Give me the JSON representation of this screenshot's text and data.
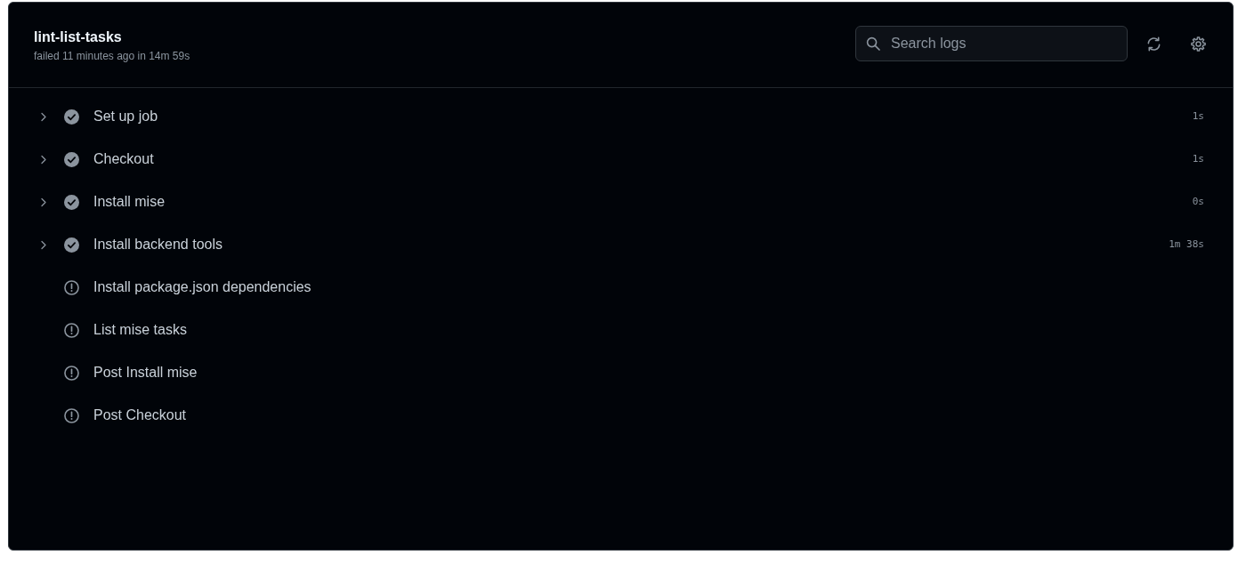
{
  "job": {
    "title": "lint-list-tasks",
    "subtitle": "failed 11 minutes ago in 14m 59s"
  },
  "search": {
    "placeholder": "Search logs"
  },
  "steps": [
    {
      "kind": "success",
      "name": "Set up job",
      "duration": "1s",
      "expanded": false
    },
    {
      "kind": "success",
      "name": "Checkout",
      "duration": "1s",
      "expanded": false
    },
    {
      "kind": "success",
      "name": "Install mise",
      "duration": "0s",
      "expanded": false
    },
    {
      "kind": "success",
      "name": "Install backend tools",
      "duration": "1m 38s",
      "expanded": false
    },
    {
      "kind": "skipped",
      "name": "Install package.json dependencies"
    },
    {
      "kind": "skipped",
      "name": "List mise tasks"
    },
    {
      "kind": "skipped",
      "name": "Post Install mise"
    },
    {
      "kind": "skipped",
      "name": "Post Checkout"
    }
  ]
}
